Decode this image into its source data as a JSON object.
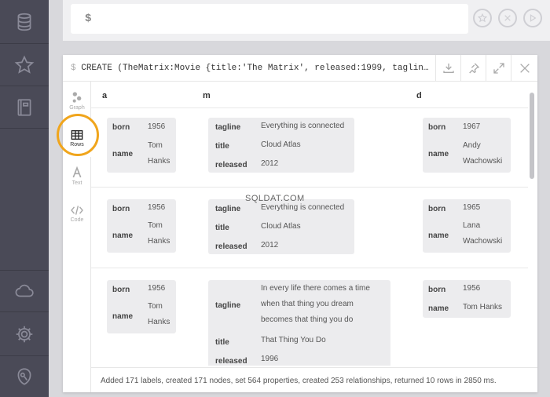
{
  "editor": {
    "prompt": "$"
  },
  "frame": {
    "prompt": "$",
    "command": "CREATE (TheMatrix:Movie {title:'The Matrix', released:1999, tagline:'Wel…"
  },
  "view_tabs": [
    {
      "label": "Graph"
    },
    {
      "label": "Rows"
    },
    {
      "label": "Text"
    },
    {
      "label": "Code"
    }
  ],
  "columns": [
    "a",
    "m",
    "d"
  ],
  "rows": [
    {
      "a": [
        {
          "key": "born",
          "value": "1956"
        },
        {
          "key": "name",
          "value": "Tom Hanks"
        }
      ],
      "m": [
        {
          "key": "tagline",
          "value": "Everything is connected"
        },
        {
          "key": "title",
          "value": "Cloud Atlas"
        },
        {
          "key": "released",
          "value": "2012"
        }
      ],
      "d": [
        {
          "key": "born",
          "value": "1967"
        },
        {
          "key": "name",
          "value": "Andy Wachowski"
        }
      ]
    },
    {
      "a": [
        {
          "key": "born",
          "value": "1956"
        },
        {
          "key": "name",
          "value": "Tom Hanks"
        }
      ],
      "m": [
        {
          "key": "tagline",
          "value": "Everything is connected"
        },
        {
          "key": "title",
          "value": "Cloud Atlas"
        },
        {
          "key": "released",
          "value": "2012"
        }
      ],
      "d": [
        {
          "key": "born",
          "value": "1965"
        },
        {
          "key": "name",
          "value": "Lana Wachowski"
        }
      ]
    },
    {
      "a": [
        {
          "key": "born",
          "value": "1956"
        },
        {
          "key": "name",
          "value": "Tom Hanks"
        }
      ],
      "m": [
        {
          "key": "tagline",
          "value": "In every life there comes a time when that thing you dream becomes that thing you do"
        },
        {
          "key": "title",
          "value": "That Thing You Do"
        },
        {
          "key": "released",
          "value": "1996"
        }
      ],
      "d": [
        {
          "key": "born",
          "value": "1956"
        },
        {
          "key": "name",
          "value": "Tom Hanks"
        }
      ]
    }
  ],
  "status": "Added 171 labels, created 171 nodes, set 564 properties, created 253 relationships, returned 10 rows in 2850 ms.",
  "watermark": "SQLDAT.COM",
  "colors": {
    "sidebar": "#4a4a57",
    "highlight_ring": "#f0a51c"
  }
}
